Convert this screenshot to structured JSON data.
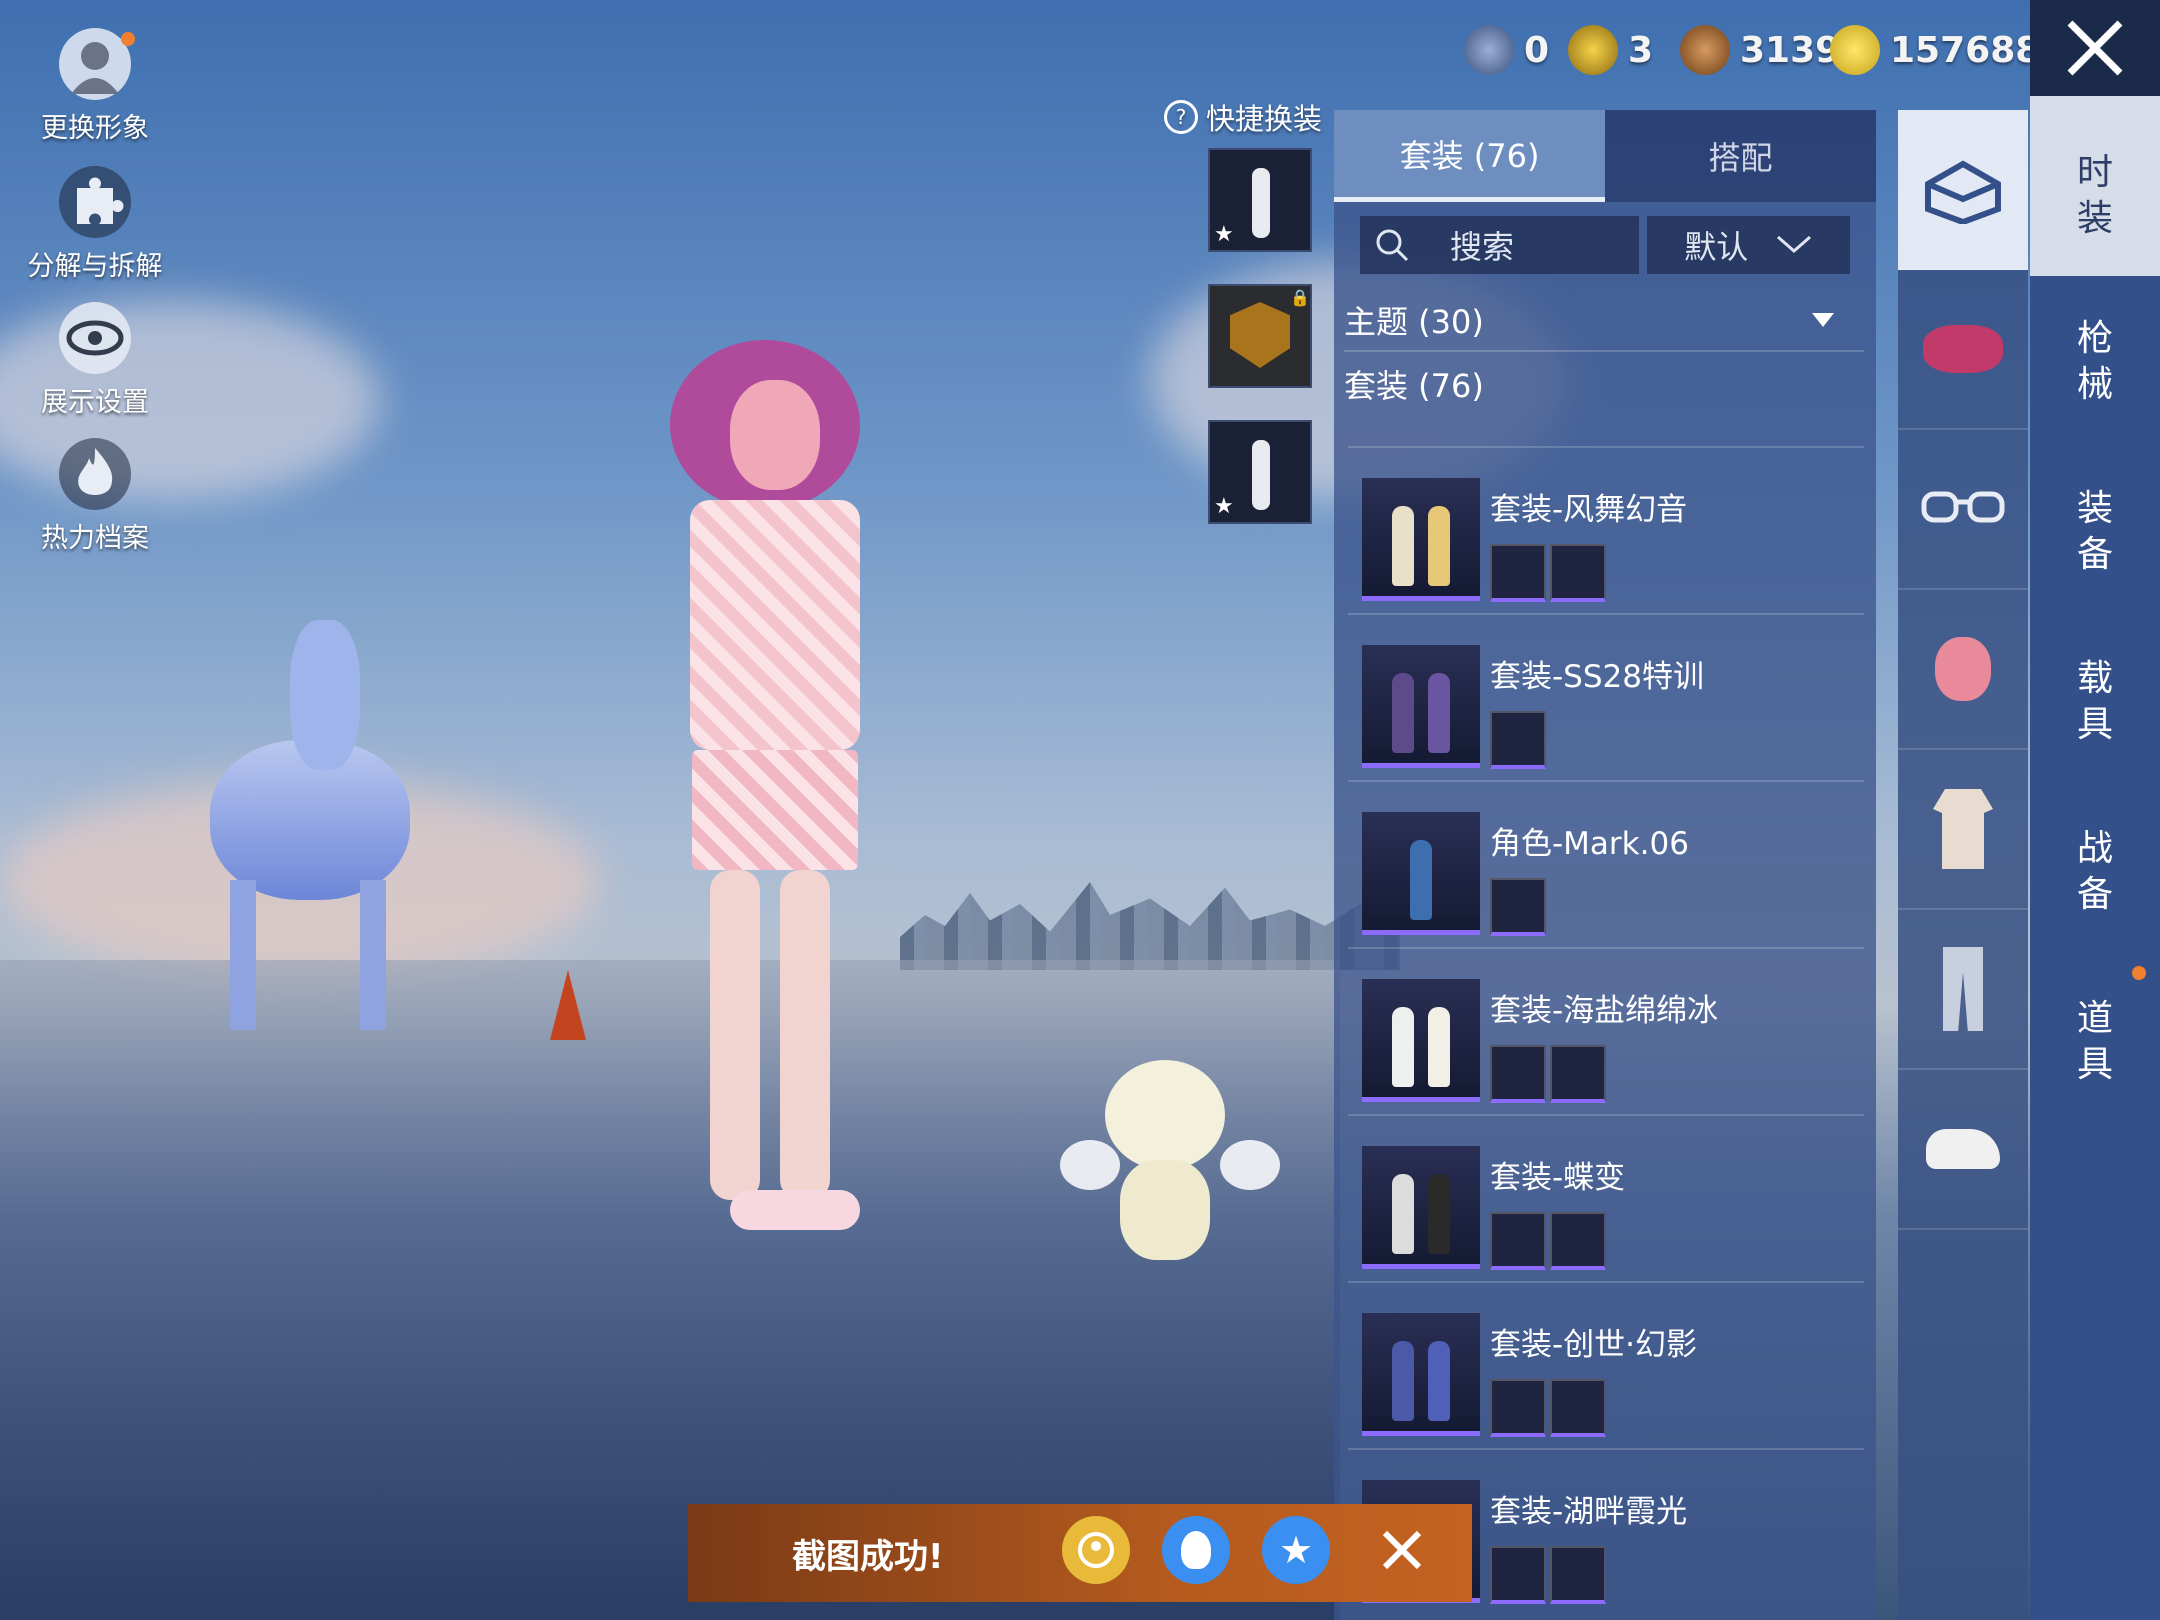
{
  "left_menu": [
    {
      "label": "更换形象",
      "icon": "avatar-icon"
    },
    {
      "label": "分解与拆解",
      "icon": "puzzle-icon"
    },
    {
      "label": "展示设置",
      "icon": "eye-icon"
    },
    {
      "label": "热力档案",
      "icon": "flame-icon"
    }
  ],
  "currencies": [
    {
      "icon": "medal-icon",
      "value": "0"
    },
    {
      "icon": "badge-icon",
      "value": "3"
    },
    {
      "icon": "bronze-coin-icon",
      "value": "3139"
    },
    {
      "icon": "lightning-coin-icon",
      "value": "157688"
    }
  ],
  "quick_dress": {
    "label": "快捷换装"
  },
  "tabs": [
    {
      "label": "套装 (76)",
      "active": true
    },
    {
      "label": "搭配",
      "active": false
    }
  ],
  "search": {
    "label": "搜索",
    "sort": "默认"
  },
  "sections": {
    "theme": "主题 (30)",
    "sets": "套装 (76)"
  },
  "items": [
    {
      "name": "套装-风舞幻音"
    },
    {
      "name": "套装-SS28特训"
    },
    {
      "name": "角色-Mark.06"
    },
    {
      "name": "套装-海盐绵绵冰"
    },
    {
      "name": "套装-蝶变"
    },
    {
      "name": "套装-创世·幻影"
    },
    {
      "name": "套装-湖畔霞光"
    }
  ],
  "categories": [
    {
      "label": "时装",
      "active": true
    },
    {
      "label": "枪械",
      "active": false
    },
    {
      "label": "装备",
      "active": false
    },
    {
      "label": "载具",
      "active": false
    },
    {
      "label": "战备",
      "active": false
    },
    {
      "label": "道具",
      "active": false
    }
  ],
  "toast": {
    "text": "截图成功!"
  },
  "colors": {
    "accent_purple": "#8b6cff",
    "panel": "#3c558c",
    "notification": "#f08030"
  }
}
